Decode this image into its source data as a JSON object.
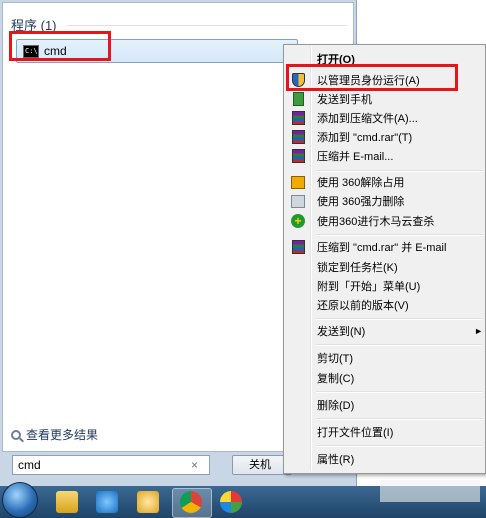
{
  "start_menu": {
    "section_header": "程序 (1)",
    "result": {
      "label": "cmd",
      "icon": "console-icon"
    },
    "see_more": "查看更多结果",
    "search_value": "cmd",
    "clear_glyph": "×",
    "shutdown_label": "关机"
  },
  "context_menu": {
    "items": [
      {
        "label": "打开(O)",
        "icon": "",
        "bold": true
      },
      {
        "label": "以管理员身份运行(A)",
        "icon": "shield-icon"
      },
      {
        "label": "发送到手机",
        "icon": "phone-icon"
      },
      {
        "label": "添加到压缩文件(A)...",
        "icon": "winrar-icon"
      },
      {
        "label": "添加到 \"cmd.rar\"(T)",
        "icon": "winrar-icon"
      },
      {
        "label": "压缩并 E-mail...",
        "icon": "winrar-icon"
      },
      {
        "label": "使用 360解除占用",
        "icon": "360-unlock-icon"
      },
      {
        "label": "使用 360强力删除",
        "icon": "360-delete-icon"
      },
      {
        "label": "使用360进行木马云查杀",
        "icon": "360-scan-icon"
      },
      {
        "label": "压缩到 \"cmd.rar\" 并 E-mail",
        "icon": "winrar-icon"
      },
      {
        "label": "锁定到任务栏(K)",
        "icon": ""
      },
      {
        "label": "附到「开始」菜单(U)",
        "icon": ""
      },
      {
        "label": "还原以前的版本(V)",
        "icon": ""
      },
      {
        "label": "发送到(N)",
        "icon": "",
        "submenu_arrow": "►"
      },
      {
        "label": "剪切(T)",
        "icon": ""
      },
      {
        "label": "复制(C)",
        "icon": ""
      },
      {
        "label": "删除(D)",
        "icon": ""
      },
      {
        "label": "打开文件位置(I)",
        "icon": ""
      },
      {
        "label": "属性(R)",
        "icon": ""
      }
    ]
  },
  "highlight_color": "#e8141a"
}
